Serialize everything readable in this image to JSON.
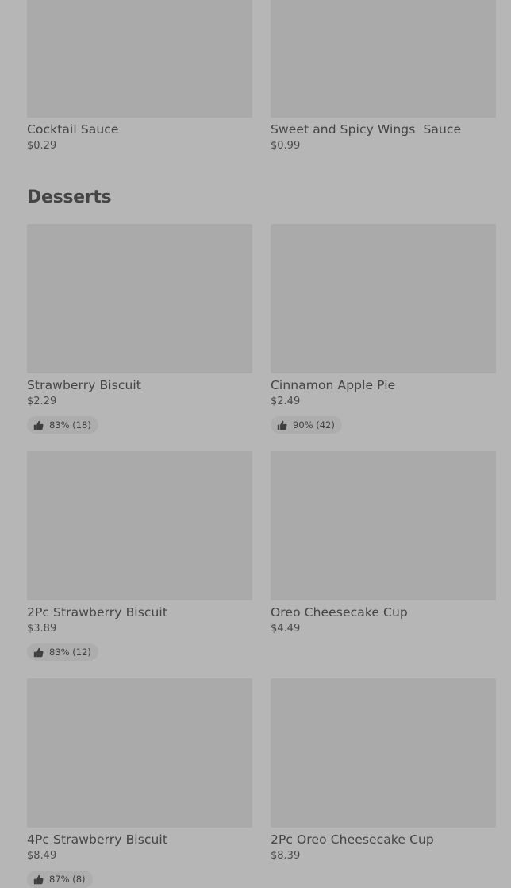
{
  "sauces": [
    {
      "name": "Cocktail Sauce",
      "price": "$0.29"
    },
    {
      "name": "Sweet and Spicy Wings  Sauce",
      "price": "$0.99"
    }
  ],
  "desserts": {
    "title": "Desserts",
    "items": [
      {
        "name": "Strawberry Biscuit",
        "price": "$2.29",
        "rating": "83% (18)"
      },
      {
        "name": "Cinnamon Apple Pie",
        "price": "$2.49",
        "rating": "90% (42)"
      },
      {
        "name": "2Pc Strawberry Biscuit",
        "price": "$3.89",
        "rating": "83% (12)"
      },
      {
        "name": "Oreo Cheesecake Cup",
        "price": "$4.49"
      },
      {
        "name": "4Pc Strawberry Biscuit",
        "price": "$8.49",
        "rating": "87% (8)"
      },
      {
        "name": "2Pc Oreo Cheesecake Cup",
        "price": "$8.39"
      }
    ]
  },
  "icons": {
    "rating": "thumbs-up-icon"
  },
  "colors": {
    "background": "#b6b6b6",
    "image_placeholder": "#aaaaaa",
    "rating_pill": "#adadad",
    "text": "#444444"
  }
}
